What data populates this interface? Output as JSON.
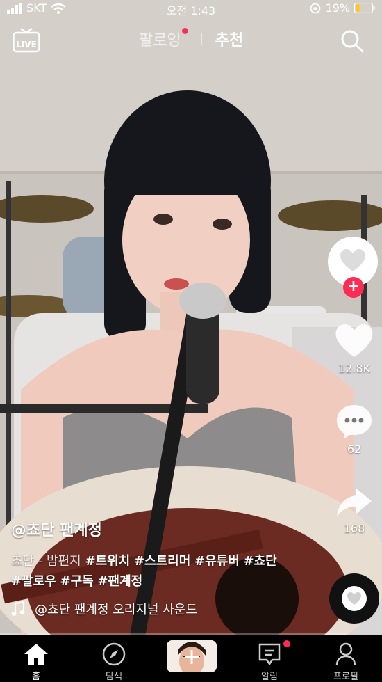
{
  "status_bar": {
    "carrier": "SKT",
    "time": "오전 1:43",
    "battery": "19%"
  },
  "top_bar": {
    "live_label": "LIVE",
    "tab_following": "팔로잉",
    "tab_recommended": "추천"
  },
  "actions": {
    "likes": "12.8K",
    "comments": "62",
    "shares": "168"
  },
  "caption": {
    "author": "@쵸단 팬계정",
    "description_plain": "쵸단 - 밤편지 ",
    "hashtags": [
      "#트위치",
      "#스트리머",
      "#유튜버",
      "#쵸단",
      "#팔로우",
      "#구독",
      "#팬계정"
    ],
    "sound": "@쵸단 팬계정 오리지널 사운드"
  },
  "nav": {
    "home": "홈",
    "explore": "탐색",
    "alerts": "알림",
    "profile": "프로필"
  },
  "colors": {
    "accent": "#fe2c55",
    "bar": "#000000"
  },
  "icons": [
    "live-icon",
    "search-icon",
    "heart-icon",
    "comment-icon",
    "share-icon",
    "music-note-icon",
    "home-icon",
    "compass-icon",
    "inbox-icon",
    "person-icon"
  ]
}
